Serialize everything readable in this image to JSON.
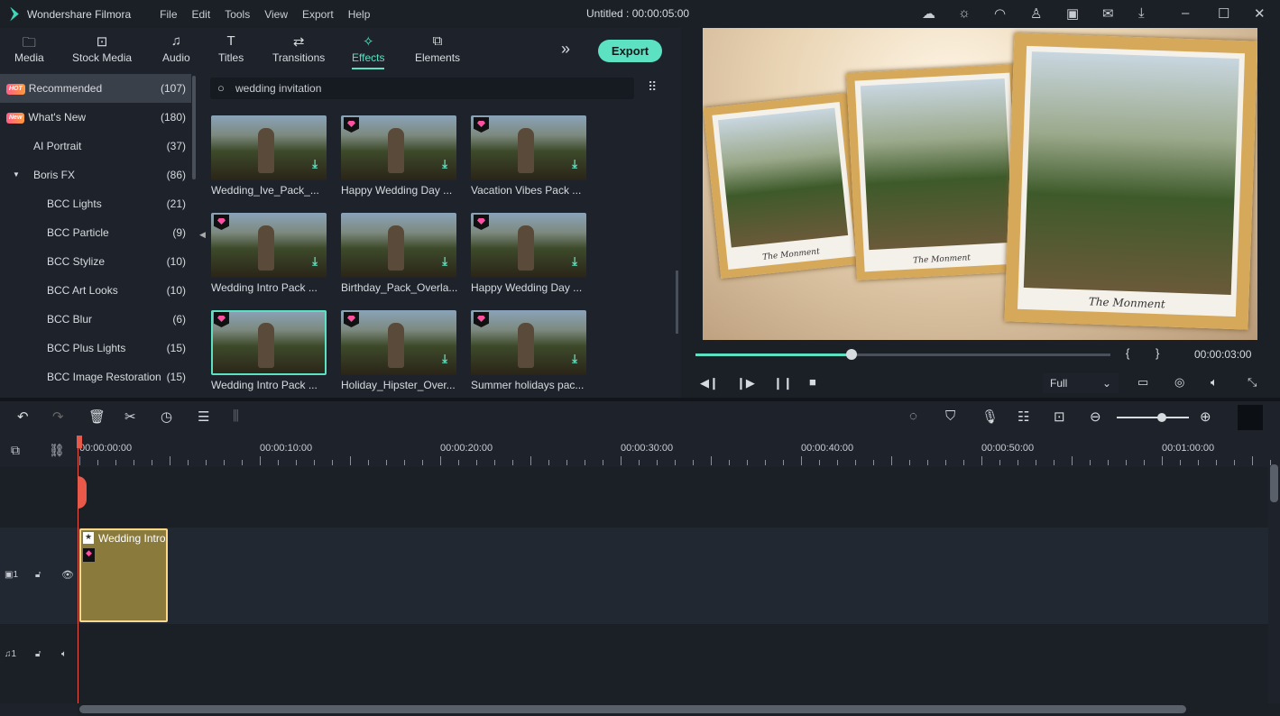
{
  "app": {
    "name": "Wondershare Filmora",
    "title": "Untitled : 00:00:05:00",
    "menu": [
      "File",
      "Edit",
      "Tools",
      "View",
      "Export",
      "Help"
    ],
    "window_icons": [
      "cloud-icon",
      "bulb-icon",
      "headset-icon",
      "user-icon",
      "save-icon",
      "mail-icon",
      "download-icon",
      "minimize-icon",
      "maximize-icon",
      "close-icon"
    ]
  },
  "tabs": [
    {
      "label": "Media",
      "icon": "folder-icon"
    },
    {
      "label": "Stock Media",
      "icon": "stock-media-icon"
    },
    {
      "label": "Audio",
      "icon": "music-icon"
    },
    {
      "label": "Titles",
      "icon": "text-icon"
    },
    {
      "label": "Transitions",
      "icon": "transitions-icon"
    },
    {
      "label": "Effects",
      "icon": "effects-icon",
      "active": true
    },
    {
      "label": "Elements",
      "icon": "elements-icon"
    }
  ],
  "export_label": "Export",
  "sidebar": {
    "items": [
      {
        "label": "Recommended",
        "count": "(107)",
        "badge": "HOT",
        "selected": true
      },
      {
        "label": "What's New",
        "count": "(180)",
        "badge": "New"
      },
      {
        "label": "AI Portrait",
        "count": "(37)"
      },
      {
        "label": "Boris FX",
        "count": "(86)",
        "expanded": true
      },
      {
        "label": "BCC Lights",
        "count": "(21)"
      },
      {
        "label": "BCC Particle",
        "count": "(9)"
      },
      {
        "label": "BCC Stylize",
        "count": "(10)"
      },
      {
        "label": "BCC Art Looks",
        "count": "(10)"
      },
      {
        "label": "BCC Blur",
        "count": "(6)"
      },
      {
        "label": "BCC Plus Lights",
        "count": "(15)"
      },
      {
        "label": "BCC Image Restoration",
        "count": "(15)"
      }
    ]
  },
  "search": {
    "value": "wedding invitation"
  },
  "effects": [
    {
      "label": "Wedding_Ive_Pack_...",
      "premium": false
    },
    {
      "label": "Happy Wedding Day ...",
      "premium": true
    },
    {
      "label": "Vacation Vibes Pack ...",
      "premium": true
    },
    {
      "label": "Wedding Intro Pack ...",
      "premium": true
    },
    {
      "label": "Birthday_Pack_Overla...",
      "premium": false
    },
    {
      "label": "Happy Wedding Day ...",
      "premium": true
    },
    {
      "label": "Wedding Intro Pack ...",
      "premium": true,
      "selected": true
    },
    {
      "label": "Holiday_Hipster_Over...",
      "premium": true
    },
    {
      "label": "Summer holidays pac...",
      "premium": true
    }
  ],
  "preview": {
    "caption": "The Monment",
    "progress_percent": 37.5,
    "mark_in": "{",
    "mark_out": "}",
    "time": "00:00:03:00",
    "quality": "Full"
  },
  "timeline": {
    "ruler": [
      "00:00:00:00",
      "00:00:10:00",
      "00:00:20:00",
      "00:00:30:00",
      "00:00:40:00",
      "00:00:50:00",
      "00:01:00:00"
    ],
    "video_track": "1",
    "audio_track": "1",
    "clip_label": "Wedding Intro Pack",
    "zoom_percent": 70
  },
  "colors": {
    "accent": "#5ce1c2",
    "playhead": "#e8594a",
    "clip": "#8a7a3c"
  }
}
